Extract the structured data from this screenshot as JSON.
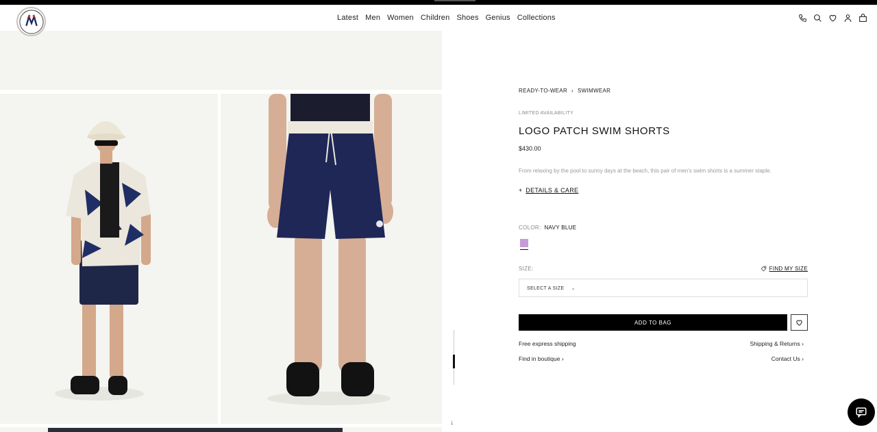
{
  "header": {
    "logo_text": "MONCLER",
    "nav": [
      "Latest",
      "Men",
      "Women",
      "Children",
      "Shoes",
      "Genius",
      "Collections"
    ],
    "icons": [
      "phone-icon",
      "search-icon",
      "heart-icon",
      "user-icon",
      "bag-icon"
    ]
  },
  "product": {
    "breadcrumb": [
      "READY-TO-WEAR",
      "SWIMWEAR"
    ],
    "availability": "LIMITED AVAILABILITY",
    "title": "LOGO PATCH SWIM SHORTS",
    "price": "$430.00",
    "description": "From relaxing by the pool to sunny days at the beach, this pair of men's swim shorts is a summer staple.",
    "details_label": "DETAILS & CARE",
    "color_label": "COLOR:",
    "color_value": "NAVY BLUE",
    "swatch_color": "#c79bd6",
    "size_label": "SIZE:",
    "find_size_label": "FIND MY SIZE",
    "size_placeholder": "SELECT A SIZE",
    "add_to_bag": "ADD TO BAG",
    "links": {
      "shipping": "Free express shipping",
      "returns": "Shipping & Returns",
      "boutique": "Find in boutique",
      "contact": "Contact Us"
    }
  }
}
